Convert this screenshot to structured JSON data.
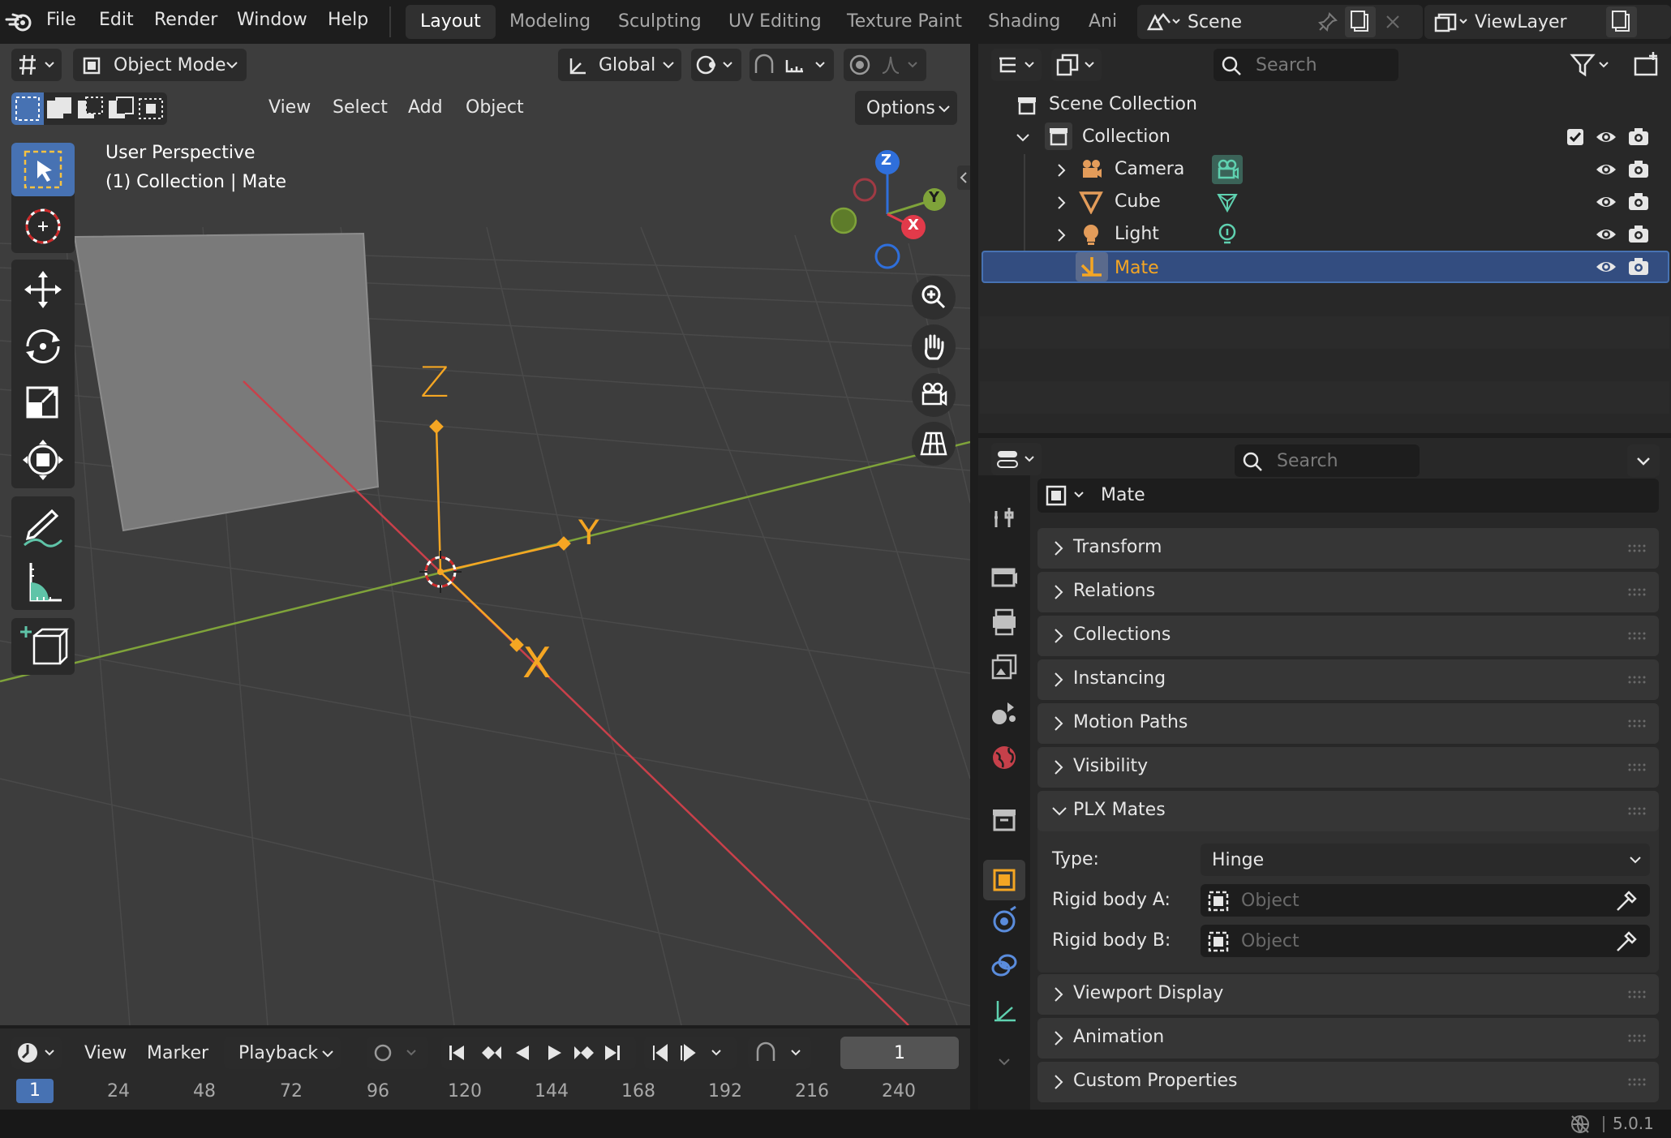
{
  "topbar": {
    "menus": [
      "File",
      "Edit",
      "Render",
      "Window",
      "Help"
    ],
    "workspaces": [
      "Layout",
      "Modeling",
      "Sculpting",
      "UV Editing",
      "Texture Paint",
      "Shading",
      "Ani"
    ],
    "active_workspace": "Layout",
    "scene": "Scene",
    "view_layer": "ViewLayer"
  },
  "viewport": {
    "mode": "Object Mode",
    "menus": [
      "View",
      "Select",
      "Add",
      "Object"
    ],
    "orientation": "Global",
    "options_label": "Options",
    "overlay_line1": "User Perspective",
    "overlay_line2": "(1) Collection | Mate",
    "axis_labels": {
      "x": "X",
      "y": "Y",
      "z": "Z"
    },
    "gizmo_labels": {
      "x": "X",
      "y": "Y",
      "z": "Z"
    }
  },
  "timeline": {
    "menus": [
      "View",
      "Marker"
    ],
    "playback": "Playback",
    "current_frame": "1",
    "frame_marker": "1",
    "frames": [
      "24",
      "48",
      "72",
      "96",
      "120",
      "144",
      "168",
      "192",
      "216",
      "240"
    ]
  },
  "outliner": {
    "search_placeholder": "Search",
    "scene_collection": "Scene Collection",
    "collection": "Collection",
    "objects": [
      {
        "name": "Camera",
        "icon": "camera-icon"
      },
      {
        "name": "Cube",
        "icon": "mesh-icon"
      },
      {
        "name": "Light",
        "icon": "light-icon"
      },
      {
        "name": "Mate",
        "icon": "empty-icon",
        "selected": true
      }
    ]
  },
  "properties": {
    "search_placeholder": "Search",
    "object_name": "Mate",
    "panels": [
      "Transform",
      "Relations",
      "Collections",
      "Instancing",
      "Motion Paths",
      "Visibility"
    ],
    "plx_panel": "PLX Mates",
    "type_label": "Type:",
    "type_value": "Hinge",
    "rigid_a_label": "Rigid body A:",
    "rigid_b_label": "Rigid body B:",
    "object_placeholder": "Object",
    "panels_after": [
      "Viewport Display",
      "Animation",
      "Custom Properties"
    ]
  },
  "status": {
    "version": "5.0.1"
  },
  "colors": {
    "accent": "#4772b3",
    "x_axis": "#c9404a",
    "y_axis": "#7fa33a",
    "selected_object": "#f5a623",
    "background": "#3d3d3d"
  }
}
